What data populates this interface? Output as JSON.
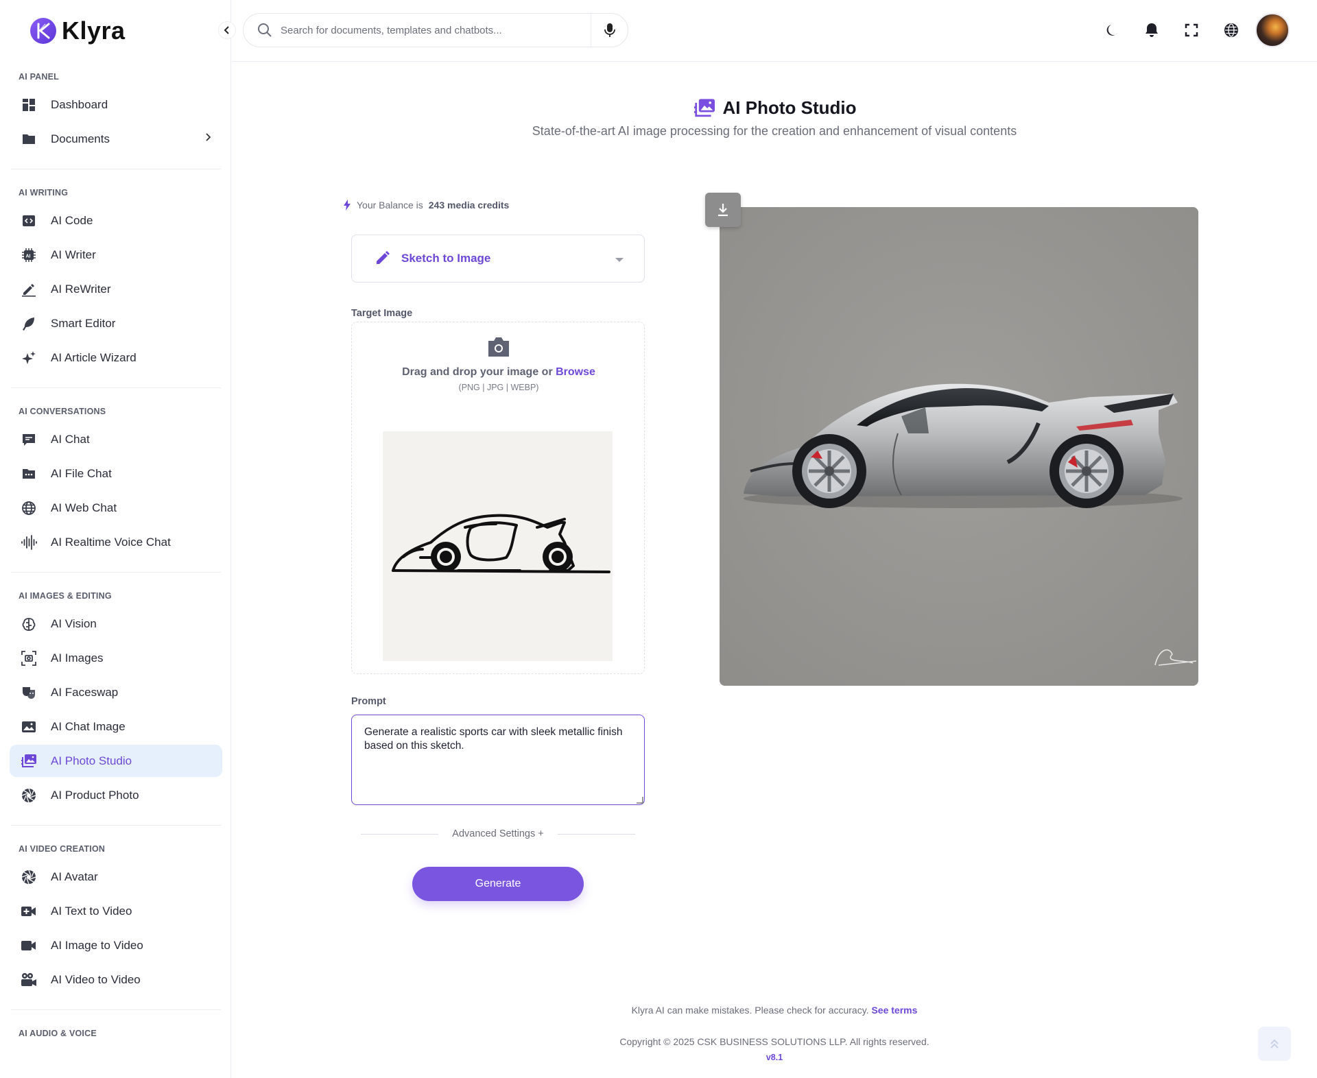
{
  "brand": {
    "name": "Klyra"
  },
  "search": {
    "placeholder": "Search for documents, templates and chatbots..."
  },
  "sidebar": {
    "sections": [
      {
        "title": "AI PANEL",
        "items": [
          {
            "label": "Dashboard",
            "icon": "dashboard-icon"
          },
          {
            "label": "Documents",
            "icon": "folder-icon",
            "has_submenu": true
          }
        ]
      },
      {
        "title": "AI WRITING",
        "items": [
          {
            "label": "AI Code",
            "icon": "code-icon"
          },
          {
            "label": "AI Writer",
            "icon": "ai-chip-icon"
          },
          {
            "label": "AI ReWriter",
            "icon": "pen-icon"
          },
          {
            "label": "Smart Editor",
            "icon": "feather-icon"
          },
          {
            "label": "AI Article Wizard",
            "icon": "sparkles-icon"
          }
        ]
      },
      {
        "title": "AI CONVERSATIONS",
        "items": [
          {
            "label": "AI Chat",
            "icon": "chat-icon"
          },
          {
            "label": "AI File Chat",
            "icon": "file-folder-icon"
          },
          {
            "label": "AI Web Chat",
            "icon": "globe-icon"
          },
          {
            "label": "AI Realtime Voice Chat",
            "icon": "waveform-icon"
          }
        ]
      },
      {
        "title": "AI IMAGES & EDITING",
        "items": [
          {
            "label": "AI Vision",
            "icon": "brain-icon"
          },
          {
            "label": "AI Images",
            "icon": "image-scan-icon"
          },
          {
            "label": "AI Faceswap",
            "icon": "masks-icon"
          },
          {
            "label": "AI Chat Image",
            "icon": "image-icon"
          },
          {
            "label": "AI Photo Studio",
            "icon": "photo-studio-icon",
            "active": true
          },
          {
            "label": "AI Product Photo",
            "icon": "aperture-icon"
          }
        ]
      },
      {
        "title": "AI VIDEO CREATION",
        "items": [
          {
            "label": "AI Avatar",
            "icon": "aperture-icon"
          },
          {
            "label": "AI Text to Video",
            "icon": "video-plus-icon"
          },
          {
            "label": "AI Image to Video",
            "icon": "video-camera-icon"
          },
          {
            "label": "AI Video to Video",
            "icon": "film-camera-icon"
          }
        ]
      },
      {
        "title": "AI AUDIO & VOICE",
        "items": []
      }
    ]
  },
  "page": {
    "title": "AI Photo Studio",
    "subtitle": "State-of-the-art AI image processing for the creation and enhancement of visual contents"
  },
  "balance": {
    "prefix": "Your Balance is",
    "value": "243 media credits"
  },
  "mode": {
    "selected": "Sketch to Image"
  },
  "target_image": {
    "label": "Target Image",
    "drop_text": "Drag and drop your image or",
    "browse": "Browse",
    "formats": "(PNG | JPG | WEBP)"
  },
  "prompt": {
    "label": "Prompt",
    "value": "Generate a realistic sports car with sleek metallic finish based on this sketch."
  },
  "advanced": {
    "label": "Advanced Settings +"
  },
  "generate": {
    "label": "Generate"
  },
  "footer": {
    "disclaimer": "Klyra AI can make mistakes. Please check for accuracy.",
    "terms": "See terms",
    "copyright": "Copyright © 2025 CSK BUSINESS SOLUTIONS LLP. All rights reserved.",
    "version": "v8.1"
  },
  "colors": {
    "accent": "#6c47d8",
    "active_bg": "#e6f0fd",
    "button": "#7a55e0"
  }
}
